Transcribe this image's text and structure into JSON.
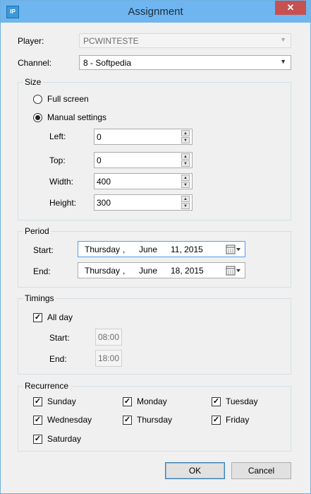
{
  "window": {
    "title": "Assignment",
    "close_glyph": "✕",
    "icon_text": "IP"
  },
  "player": {
    "label": "Player:",
    "value": "PCWINTESTE"
  },
  "channel": {
    "label": "Channel:",
    "value": "8 - Softpedia"
  },
  "size": {
    "title": "Size",
    "full_screen": "Full screen",
    "manual": "Manual settings",
    "selected": "manual",
    "left": {
      "label": "Left:",
      "value": "0"
    },
    "top": {
      "label": "Top:",
      "value": "0"
    },
    "width": {
      "label": "Width:",
      "value": "400"
    },
    "height": {
      "label": "Height:",
      "value": "300"
    }
  },
  "period": {
    "title": "Period",
    "start": {
      "label": "Start:",
      "weekday": "Thursday",
      "sep": ",",
      "month": "June",
      "day_year": "11, 2015"
    },
    "end": {
      "label": "End:",
      "weekday": "Thursday",
      "sep": ",",
      "month": "June",
      "day_year": "18, 2015"
    }
  },
  "timings": {
    "title": "Timings",
    "all_day": "All day",
    "all_day_checked": true,
    "start": {
      "label": "Start:",
      "value": "08:00"
    },
    "end": {
      "label": "End:",
      "value": "18:00"
    }
  },
  "recurrence": {
    "title": "Recurrence",
    "days": [
      {
        "label": "Sunday",
        "checked": true
      },
      {
        "label": "Monday",
        "checked": true
      },
      {
        "label": "Tuesday",
        "checked": true
      },
      {
        "label": "Wednesday",
        "checked": true
      },
      {
        "label": "Thursday",
        "checked": true
      },
      {
        "label": "Friday",
        "checked": true
      },
      {
        "label": "Saturday",
        "checked": true
      }
    ]
  },
  "buttons": {
    "ok": "OK",
    "cancel": "Cancel"
  },
  "glyphs": {
    "check": "✓",
    "combo_arrow": "▼",
    "spin_up": "▲",
    "spin_down": "▼"
  },
  "colors": {
    "titlebar": "#6fb6f0",
    "close": "#c75050",
    "focus_border": "#569de5"
  }
}
